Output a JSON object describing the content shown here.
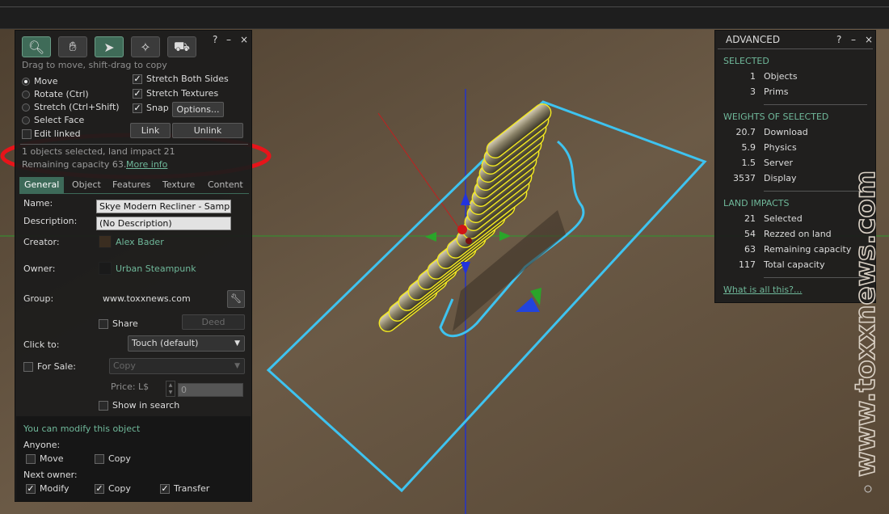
{
  "build": {
    "hint": "Drag to move, shift-drag to copy",
    "window_help": "?",
    "window_min": "–",
    "window_close": "×",
    "modes": [
      {
        "label": "Move",
        "selected": true
      },
      {
        "label": "Rotate (Ctrl)",
        "selected": false
      },
      {
        "label": "Stretch (Ctrl+Shift)",
        "selected": false
      },
      {
        "label": "Select Face",
        "selected": false
      },
      {
        "label": "Edit linked",
        "selected": false
      }
    ],
    "options": {
      "stretch_both": "Stretch Both Sides",
      "stretch_textures": "Stretch Textures",
      "snap": "Snap",
      "options_button": "Options...",
      "link_button": "Link",
      "unlink_button": "Unlink"
    },
    "status_line1": "1 objects selected, land impact 21",
    "status_line2": "Remaining capacity 63.",
    "more_info": "More info",
    "tabs": [
      "General",
      "Object",
      "Features",
      "Texture",
      "Content"
    ],
    "general": {
      "name_label": "Name:",
      "name_value": "Skye Modern Recliner - Sampl",
      "desc_label": "Description:",
      "desc_value": "(No Description)",
      "creator_label": "Creator:",
      "creator_value": "Alex Bader",
      "owner_label": "Owner:",
      "owner_value": "Urban Steampunk",
      "group_label": "Group:",
      "group_value": "www.toxxnews.com",
      "share_label": "Share",
      "deed_button": "Deed",
      "click_label": "Click to:",
      "click_value": "Touch  (default)",
      "for_sale_label": "For Sale:",
      "sale_type": "Copy",
      "price_label": "Price: L$",
      "price_value": "0",
      "show_search": "Show in search"
    },
    "perms": {
      "title": "You can modify this object",
      "anyone": "Anyone:",
      "move": "Move",
      "copy": "Copy",
      "next_owner": "Next owner:",
      "modify": "Modify",
      "copy2": "Copy",
      "transfer": "Transfer"
    }
  },
  "advanced": {
    "title": "ADVANCED",
    "help": "?",
    "min": "–",
    "close": "×",
    "selected_header": "SELECTED",
    "selected": [
      {
        "value": "1",
        "label": "Objects"
      },
      {
        "value": "3",
        "label": "Prims"
      }
    ],
    "weights_header": "WEIGHTS OF SELECTED",
    "weights": [
      {
        "value": "20.7",
        "label": "Download"
      },
      {
        "value": "5.9",
        "label": "Physics"
      },
      {
        "value": "1.5",
        "label": "Server"
      },
      {
        "value": "3537",
        "label": "Display"
      }
    ],
    "impacts_header": "LAND IMPACTS",
    "impacts": [
      {
        "value": "21",
        "label": "Selected"
      },
      {
        "value": "54",
        "label": "Rezzed on land"
      },
      {
        "value": "63",
        "label": "Remaining capacity"
      },
      {
        "value": "117",
        "label": "Total capacity"
      }
    ],
    "what_link": "What is all this?..."
  },
  "watermark": "www.toxxnews.com",
  "colors": {
    "accent": "#6fb89a",
    "highlight_ring": "#e8141a",
    "selection": "#3ec3f0",
    "tab_active": "#3d6a59"
  }
}
